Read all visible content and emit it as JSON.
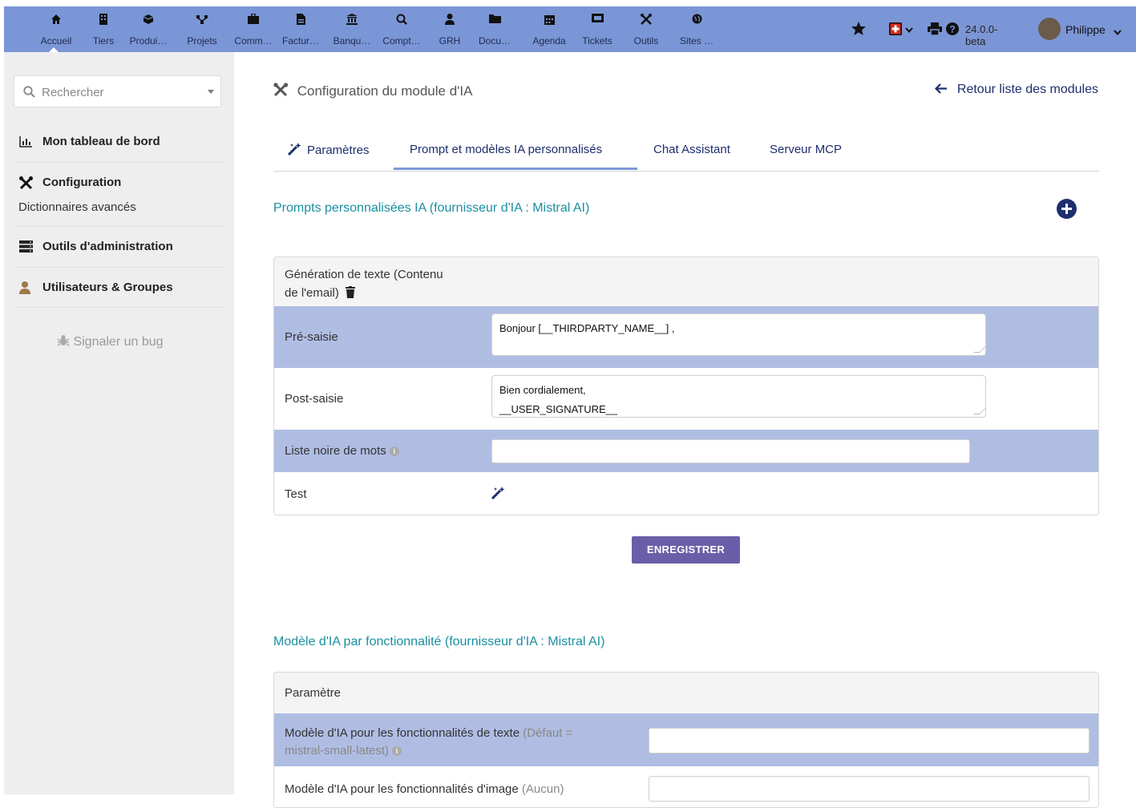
{
  "topbar": {
    "menu": [
      {
        "label": "Accueil",
        "icon": "home-icon"
      },
      {
        "label": "Tiers",
        "icon": "building-icon"
      },
      {
        "label": "Produi…",
        "icon": "cube-icon"
      },
      {
        "label": "Projets",
        "icon": "sitemap-icon"
      },
      {
        "label": "Comm…",
        "icon": "briefcase-icon"
      },
      {
        "label": "Factur…",
        "icon": "invoice-icon"
      },
      {
        "label": "Banqu…",
        "icon": "bank-icon"
      },
      {
        "label": "Compt…",
        "icon": "search-dollar-icon"
      },
      {
        "label": "GRH",
        "icon": "user-tie-icon"
      },
      {
        "label": "Docu…",
        "icon": "folder-icon"
      },
      {
        "label": "Agenda",
        "icon": "calendar-icon"
      },
      {
        "label": "Tickets",
        "icon": "ticket-icon"
      },
      {
        "label": "Outils",
        "icon": "tools-icon"
      },
      {
        "label": "Sites …",
        "icon": "globe-icon"
      }
    ],
    "version": "24.0.0-beta",
    "user": "Philippe"
  },
  "sidebar": {
    "search_placeholder": "Rechercher",
    "items": [
      {
        "label": "Mon tableau de bord",
        "icon": "chart-icon"
      },
      {
        "label": "Configuration",
        "icon": "tools-icon"
      },
      {
        "label": "Outils d'administration",
        "icon": "server-icon"
      },
      {
        "label": "Utilisateurs & Groupes",
        "icon": "user-icon"
      }
    ],
    "sub_item": "Dictionnaires avancés",
    "bug_link": "Signaler un bug"
  },
  "main": {
    "title": "Configuration du module d'IA",
    "back_link": "Retour liste des modules",
    "tabs": [
      "Paramètres",
      "Prompt et modèles IA personnalisés",
      "Chat Assistant",
      "Serveur MCP"
    ],
    "section1_title": "Prompts personnalisées IA (fournisseur d'IA : Mistral AI)",
    "card1": {
      "header_line1": "Génération de texte (Contenu",
      "header_line2": "de l'email)",
      "pre_label": "Pré-saisie",
      "pre_value": "Bonjour [__THIRDPARTY_NAME__] ,",
      "post_label": "Post-saisie",
      "post_value_line1": "Bien cordialement,",
      "post_value_line2": "__USER_SIGNATURE__",
      "blacklist_label": "Liste noire de mots",
      "test_label": "Test"
    },
    "save_button": "ENREGISTRER",
    "section2_title": "Modèle d'IA par fonctionnalité (fournisseur d'IA : Mistral AI)",
    "card2": {
      "header": "Paramètre",
      "row1_label": "Modèle d'IA pour les fonctionnalités de texte",
      "row1_hint_a": "(Défaut =",
      "row1_hint_b": "mistral-small-latest)",
      "row2_label": "Modèle d'IA pour les fonctionnalités d'image",
      "row2_hint": "(Aucun)"
    }
  },
  "colors": {
    "topbar": "#7b96d6",
    "navy": "#1e2e6e",
    "teal": "#1a8fa0",
    "highlight_row": "#b0bde3",
    "save_button": "#6b5ea8"
  }
}
